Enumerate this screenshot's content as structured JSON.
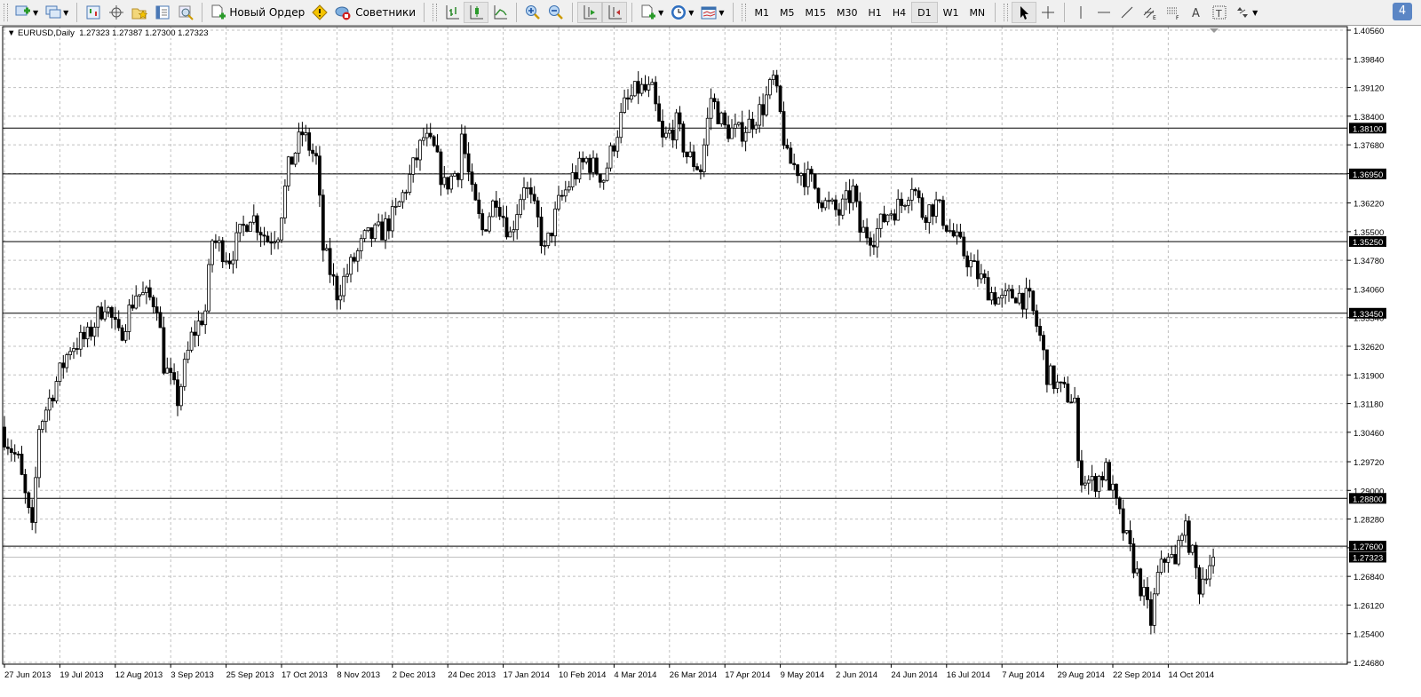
{
  "toolbar": {
    "new_order_label": "Новый Ордер",
    "experts_label": "Советники",
    "timeframes": [
      "M1",
      "M5",
      "M15",
      "M30",
      "H1",
      "H4",
      "D1",
      "W1",
      "MN"
    ],
    "active_timeframe": "D1",
    "notification_count": "4"
  },
  "chart": {
    "symbol_info": "EURUSD,Daily",
    "ohlc": "1.27323 1.27387 1.27300 1.27323",
    "current_price": "1.27323"
  },
  "chart_data": {
    "type": "candlestick",
    "symbol": "EURUSD",
    "timeframe": "Daily",
    "ylim": [
      1.2468,
      1.4056
    ],
    "y_ticks": [
      "1.40560",
      "1.39840",
      "1.39120",
      "1.38400",
      "1.37680",
      "1.36960",
      "1.36220",
      "1.35500",
      "1.34780",
      "1.34060",
      "1.33340",
      "1.32620",
      "1.31900",
      "1.31180",
      "1.30460",
      "1.29720",
      "1.29000",
      "1.28280",
      "1.27560",
      "1.26840",
      "1.26120",
      "1.25400",
      "1.24680"
    ],
    "x_ticks": [
      "27 Jun 2013",
      "19 Jul 2013",
      "12 Aug 2013",
      "3 Sep 2013",
      "25 Sep 2013",
      "17 Oct 2013",
      "8 Nov 2013",
      "2 Dec 2013",
      "24 Dec 2013",
      "17 Jan 2014",
      "10 Feb 2014",
      "4 Mar 2014",
      "26 Mar 2014",
      "17 Apr 2014",
      "9 May 2014",
      "2 Jun 2014",
      "24 Jun 2014",
      "16 Jul 2014",
      "7 Aug 2014",
      "29 Aug 2014",
      "22 Sep 2014",
      "14 Oct 2014"
    ],
    "bars_per_x_tick": 16,
    "horizontal_levels": [
      "1.38100",
      "1.36950",
      "1.35250",
      "1.33450",
      "1.28800",
      "1.27600"
    ],
    "close_path": [
      [
        0,
        1.3039
      ],
      [
        4,
        1.2972
      ],
      [
        8,
        1.2794
      ],
      [
        10,
        1.3061
      ],
      [
        14,
        1.3151
      ],
      [
        19,
        1.3262
      ],
      [
        24,
        1.3284
      ],
      [
        29,
        1.3374
      ],
      [
        33,
        1.3284
      ],
      [
        38,
        1.3396
      ],
      [
        44,
        1.3374
      ],
      [
        46,
        1.3218
      ],
      [
        50,
        1.3128
      ],
      [
        54,
        1.3284
      ],
      [
        58,
        1.3351
      ],
      [
        60,
        1.353
      ],
      [
        65,
        1.3485
      ],
      [
        71,
        1.3597
      ],
      [
        76,
        1.353
      ],
      [
        79,
        1.3552
      ],
      [
        82,
        1.3708
      ],
      [
        86,
        1.3797
      ],
      [
        90,
        1.373
      ],
      [
        92,
        1.3507
      ],
      [
        96,
        1.3396
      ],
      [
        100,
        1.3463
      ],
      [
        104,
        1.353
      ],
      [
        109,
        1.3552
      ],
      [
        113,
        1.3597
      ],
      [
        117,
        1.3686
      ],
      [
        121,
        1.3786
      ],
      [
        124,
        1.3753
      ],
      [
        127,
        1.3664
      ],
      [
        131,
        1.3708
      ],
      [
        132,
        1.3797
      ],
      [
        135,
        1.3641
      ],
      [
        138,
        1.3552
      ],
      [
        142,
        1.3641
      ],
      [
        146,
        1.3541
      ],
      [
        150,
        1.3675
      ],
      [
        154,
        1.3574
      ],
      [
        156,
        1.3496
      ],
      [
        160,
        1.3619
      ],
      [
        164,
        1.3686
      ],
      [
        168,
        1.373
      ],
      [
        173,
        1.3686
      ],
      [
        176,
        1.3775
      ],
      [
        179,
        1.3864
      ],
      [
        183,
        1.3909
      ],
      [
        187,
        1.3898
      ],
      [
        190,
        1.3775
      ],
      [
        194,
        1.382
      ],
      [
        197,
        1.3742
      ],
      [
        201,
        1.3708
      ],
      [
        204,
        1.3887
      ],
      [
        208,
        1.3808
      ],
      [
        212,
        1.3797
      ],
      [
        215,
        1.382
      ],
      [
        219,
        1.3864
      ],
      [
        222,
        1.3931
      ],
      [
        224,
        1.3842
      ],
      [
        226,
        1.373
      ],
      [
        229,
        1.3708
      ],
      [
        233,
        1.3675
      ],
      [
        237,
        1.3619
      ],
      [
        241,
        1.3597
      ],
      [
        245,
        1.3652
      ],
      [
        247,
        1.3552
      ],
      [
        251,
        1.3541
      ],
      [
        255,
        1.3597
      ],
      [
        259,
        1.3619
      ],
      [
        262,
        1.3675
      ],
      [
        265,
        1.3597
      ],
      [
        269,
        1.3619
      ],
      [
        273,
        1.3552
      ],
      [
        277,
        1.3496
      ],
      [
        281,
        1.3441
      ],
      [
        285,
        1.3396
      ],
      [
        288,
        1.3374
      ],
      [
        292,
        1.3396
      ],
      [
        296,
        1.3374
      ],
      [
        299,
        1.3284
      ],
      [
        301,
        1.3195
      ],
      [
        305,
        1.3151
      ],
      [
        309,
        1.3128
      ],
      [
        310,
        1.295
      ],
      [
        314,
        1.2916
      ],
      [
        318,
        1.295
      ],
      [
        321,
        1.2861
      ],
      [
        324,
        1.2772
      ],
      [
        328,
        1.266
      ],
      [
        331,
        1.2571
      ],
      [
        333,
        1.2682
      ],
      [
        336,
        1.2749
      ],
      [
        338,
        1.2705
      ],
      [
        340,
        1.2816
      ],
      [
        342,
        1.2772
      ],
      [
        345,
        1.266
      ],
      [
        347,
        1.2705
      ],
      [
        349,
        1.27323
      ]
    ]
  }
}
